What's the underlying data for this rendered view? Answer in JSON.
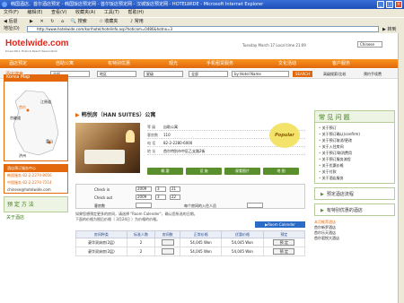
{
  "window": {
    "title": "韩国酒店、首尔酒店预定 - 韩国饭店预定网 - 首尔饭店预定网 - 汉城饭店预定网 - HOTELWIDE - Microsoft Internet Explorer"
  },
  "menu": [
    "文件(F)",
    "编辑(E)",
    "查看(V)",
    "收藏夹(A)",
    "工具(T)",
    "帮助(H)"
  ],
  "toolbar": [
    "后退",
    "",
    "搜索",
    "收藏夹",
    "",
    "常用"
  ],
  "address": {
    "label": "地址(D)",
    "url": "http://www.hotelwide.com/kor/hotel/hotelinfo.asp?hoticom=0486&hotno=3",
    "go": "转到"
  },
  "site": {
    "logo": "Hotelwide.com",
    "logo_sub": "Korea NO.1 Hotel & Resort Reservation",
    "date": "Tuesday March 17 Local time 21:09",
    "lang": "Chinese"
  },
  "nav": [
    "酒店预定",
    "自助公寓",
    "有特别优惠",
    "观光",
    "手机租赁服务",
    "文化活动",
    "客户服务"
  ],
  "search": {
    "label": "酒店搜索",
    "region": "全部",
    "area": "地区",
    "star": "星级",
    "type": "全部",
    "byname": "by Hotel Name",
    "btn": "SEARCH",
    "link1": "高级搜索/比较",
    "link2": "预约手续费"
  },
  "map": {
    "title": "Korea Map",
    "cities": [
      "首尔",
      "京畿道",
      "江原道",
      "釜山",
      "济州"
    ]
  },
  "hotline": {
    "title": "酒店预订服务中心",
    "phone1": "韩国服务 82-2-2274-8056",
    "phone2": "中国服务 82-2-2274-7214",
    "email": "chinese@hotelwide.com"
  },
  "note": {
    "title": "预 定 方 法",
    "sub": "关于酒店"
  },
  "hotel": {
    "name": "韩悦房（HAN SUITES）公寓",
    "star_label": "等  级",
    "star_val": "自助公寓",
    "rooms_label": "客房数",
    "rooms_val": "110",
    "tel_label": "电  话",
    "tel_val": "82-2-2280-6000",
    "addr_label": "地  址",
    "addr_val": "首尔特别市中区乙支路2街",
    "popular": "Popular"
  },
  "buttons": [
    "概  要",
    "设  施",
    "观看图片",
    "地  图"
  ],
  "form": {
    "checkin": "Check in",
    "checkout": "Check out",
    "checkin_vals": [
      "2009",
      "3",
      "21"
    ],
    "checkout_vals": [
      "2009",
      "3",
      "22"
    ],
    "rooms": "客房数",
    "people": "每个房间的入住人员"
  },
  "desc": "如果您想预定更多的房间，请选择 \"Room Calender\"，确认您所选的日期。",
  "desc2": "下面的价格为税后价格（ 3月24日 ）为价格的价格。",
  "calbtn": "▶Room Calender",
  "table": {
    "headers": [
      "房间种类",
      "标准人数",
      "房间数",
      "正常价格",
      "优惠价格",
      "预定"
    ],
    "rows": [
      [
        "豪华双床房(2层)",
        "2",
        "",
        "54,045 Won",
        "54,045 Won",
        "预  定"
      ],
      [
        "豪华双床房(2层)",
        "2",
        "",
        "54,045 Won",
        "54,045 Won",
        "预  定"
      ]
    ]
  },
  "right": {
    "faq_title": "常 见 问 题",
    "faq": [
      "关于预订",
      "关于预订确认(confirm)",
      "关于预订取消/更改",
      "关于入住房间",
      "关于预订/取消费用",
      "关于预订服务流程",
      "关于优惠价格",
      "关于付款",
      "关于酒店服务"
    ],
    "box1": "预定酒店流程",
    "box2": "有特别优惠的酒店",
    "links_title": "本月推荐酒店",
    "links": [
      "首尔新罗酒店",
      "首尔乐天酒店",
      "首尔君悦大酒店"
    ]
  }
}
